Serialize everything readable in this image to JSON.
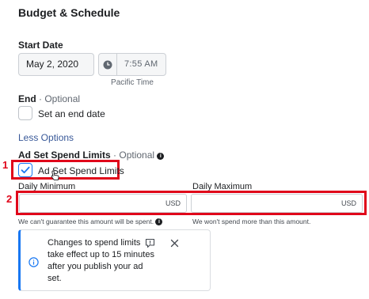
{
  "section": {
    "title": "Budget & Schedule"
  },
  "start_date": {
    "label": "Start Date",
    "date_value": "May 2, 2020",
    "time_value": "7:55 AM",
    "timezone": "Pacific Time",
    "clock_icon": "clock-icon"
  },
  "end": {
    "label": "End",
    "optional": "· Optional",
    "checkbox_label": "Set an end date",
    "checked": false
  },
  "less_options": {
    "label": "Less Options"
  },
  "ad_set_spend_limits": {
    "label": "Ad Set Spend Limits",
    "optional": "· Optional",
    "info_icon": "info-icon",
    "checkbox_label": "Ad Set Spend Limits",
    "checked": true,
    "daily_min": {
      "label": "Daily Minimum",
      "currency": "USD",
      "value": "",
      "helper": "We can't guarantee this amount will be spent."
    },
    "daily_max": {
      "label": "Daily Maximum",
      "currency": "USD",
      "value": "",
      "helper": "We won't spend more than this amount."
    }
  },
  "annotations": {
    "badge1": "1",
    "badge2": "2",
    "highlight_color": "#e0051a"
  },
  "notice": {
    "text": "Changes to spend limits take effect up to 15 minutes after you publish your ad set.",
    "accent": "#1877f2"
  }
}
